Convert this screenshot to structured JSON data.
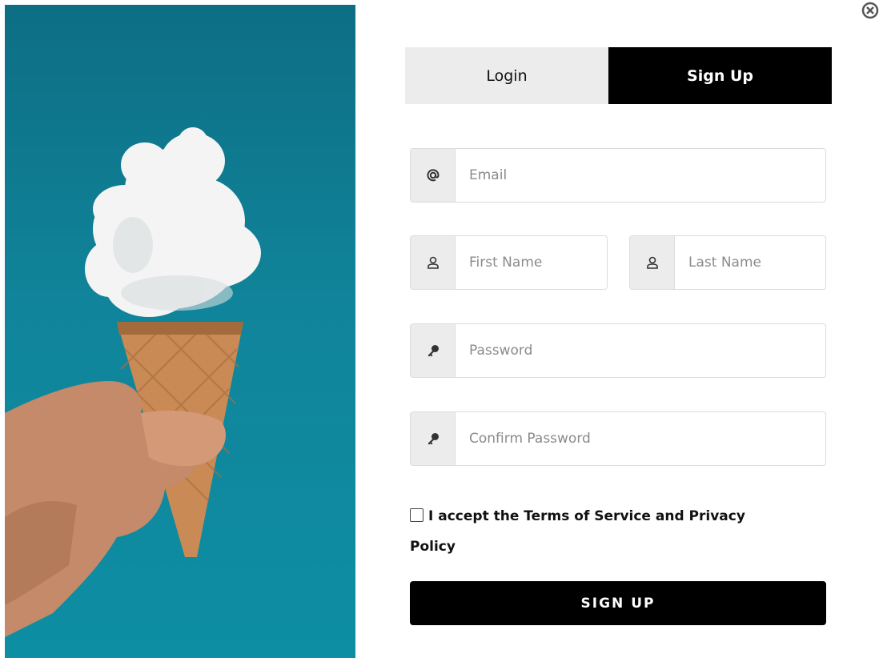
{
  "tabs": {
    "login": "Login",
    "signup": "Sign Up"
  },
  "fields": {
    "email": {
      "icon": "at-icon",
      "placeholder": "Email",
      "value": ""
    },
    "first_name": {
      "icon": "user-icon",
      "placeholder": "First Name",
      "value": ""
    },
    "last_name": {
      "icon": "user-icon",
      "placeholder": "Last Name",
      "value": ""
    },
    "password": {
      "icon": "key-icon",
      "placeholder": "Password",
      "value": ""
    },
    "confirm_password": {
      "icon": "key-icon",
      "placeholder": "Confirm Password",
      "value": ""
    }
  },
  "terms": {
    "label": "I accept the Terms of Service and Privacy Policy",
    "checked": false
  },
  "submit_label": "SIGN UP",
  "close_icon": "close-circle-icon",
  "hero_image": {
    "subject": "hand-holding-ice-cream-cone-with-cloud"
  },
  "colors": {
    "accent": "#000000",
    "tab_inactive": "#ececec",
    "hero_bg": "#0e7f95"
  }
}
